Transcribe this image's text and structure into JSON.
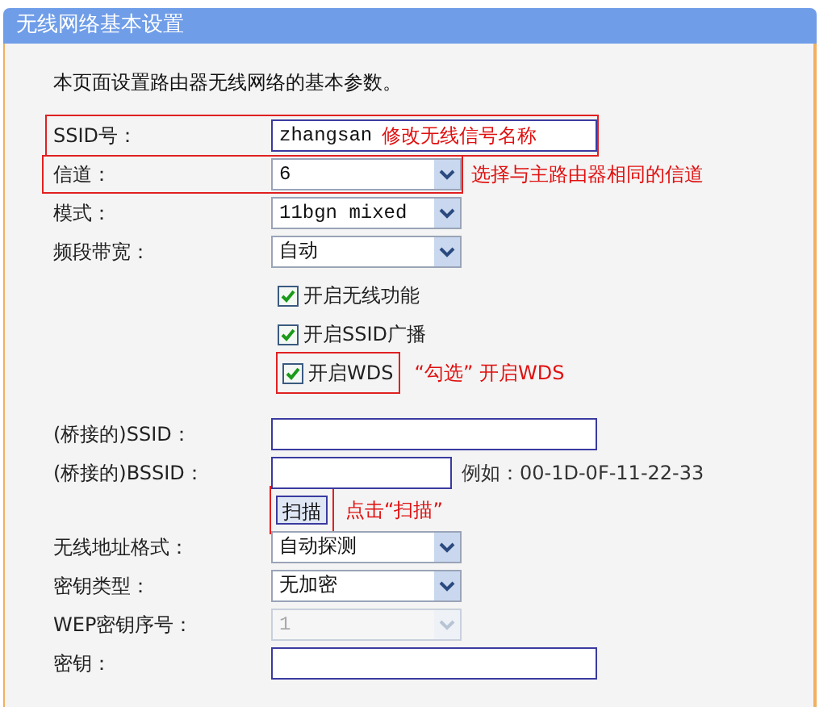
{
  "header": {
    "title": "无线网络基本设置"
  },
  "intro": "本页面设置路由器无线网络的基本参数。",
  "rows": [
    {
      "kind": "text",
      "label": "SSID号：",
      "value": "zhangsan",
      "highlighted": true,
      "note": "修改无线信号名称"
    },
    {
      "kind": "select",
      "label": "信道：",
      "value": "6",
      "disabled": false,
      "highlighted": true,
      "note": "选择与主路由器相同的信道"
    },
    {
      "kind": "select",
      "label": "模式：",
      "value": "11bgn mixed",
      "disabled": false,
      "highlighted": false
    },
    {
      "kind": "select",
      "label": "频段带宽：",
      "value": "自动",
      "disabled": false,
      "highlighted": false
    },
    {
      "kind": "checkbox",
      "text": "开启无线功能",
      "checked": true,
      "highlighted": false
    },
    {
      "kind": "checkbox",
      "text": "开启SSID广播",
      "checked": true,
      "highlighted": false
    },
    {
      "kind": "checkbox",
      "text": "开启WDS",
      "checked": true,
      "highlighted": true,
      "note": "“勾选” 开启WDS"
    },
    {
      "kind": "text",
      "label": "(桥接的)SSID：",
      "highlighted": false
    },
    {
      "kind": "text",
      "label": "(桥接的)BSSID：",
      "hint": "例如：00-1D-0F-11-22-33",
      "highlighted": false
    },
    {
      "kind": "button",
      "text": "扫描",
      "highlighted": true,
      "note": "点击“扫描”"
    },
    {
      "kind": "select",
      "label": "无线地址格式：",
      "value": "自动探测",
      "disabled": false,
      "highlighted": false
    },
    {
      "kind": "select",
      "label": "密钥类型：",
      "value": "无加密",
      "disabled": false,
      "highlighted": false
    },
    {
      "kind": "select",
      "label": "WEP密钥序号：",
      "value": "1",
      "disabled": true,
      "highlighted": false
    },
    {
      "kind": "text",
      "label": "密钥：",
      "highlighted": false
    }
  ]
}
